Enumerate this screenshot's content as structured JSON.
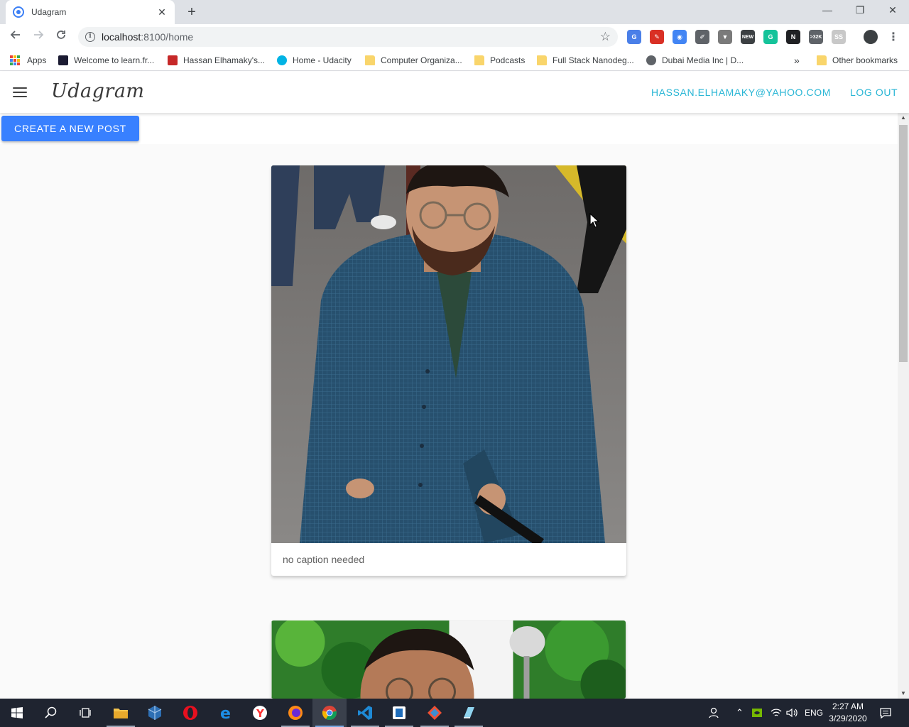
{
  "browser": {
    "tab_title": "Udagram",
    "tab_close_glyph": "✕",
    "new_tab_glyph": "+",
    "url_host": "localhost",
    "url_rest": ":8100/home",
    "window_controls": {
      "minimize": "—",
      "restore": "❐",
      "close": "✕"
    },
    "extensions": [
      {
        "icon": "google-translate-icon",
        "color": "#4a7fe8",
        "text": "G"
      },
      {
        "icon": "pin-extension-icon",
        "color": "#d93025",
        "text": "✎"
      },
      {
        "icon": "chrome-circle-icon",
        "color": "#4285f4",
        "text": "◉"
      },
      {
        "icon": "eyedropper-icon",
        "color": "#5f6368",
        "text": "✐"
      },
      {
        "icon": "vue-devtools-icon",
        "color": "#7a7a7a",
        "text": "▼"
      },
      {
        "icon": "news-icon",
        "color": "#3c4043",
        "text": "NEW"
      },
      {
        "icon": "grammarly-icon",
        "color": "#15c39a",
        "text": "G"
      },
      {
        "icon": "notion-icon",
        "color": "#202124",
        "text": "N"
      },
      {
        "icon": "gmail-checker-icon",
        "color": "#5f6368",
        "text": ">32K"
      },
      {
        "icon": "ss-extension-icon",
        "color": "#c8c8c8",
        "text": "SS"
      }
    ],
    "bookmarks": [
      {
        "label": "Apps",
        "icon": "apps-grid-icon"
      },
      {
        "label": "Welcome to learn.fr...",
        "icon": "freecodecamp-icon",
        "color": "#1b1b32"
      },
      {
        "label": "Hassan Elhamaky's...",
        "icon": "site-favicon-icon",
        "color": "#c62828"
      },
      {
        "label": "Home - Udacity",
        "icon": "udacity-icon",
        "color": "#02b3e4"
      },
      {
        "label": "Computer Organiza...",
        "icon": "folder-icon"
      },
      {
        "label": "Podcasts",
        "icon": "folder-icon"
      },
      {
        "label": "Full Stack Nanodeg...",
        "icon": "folder-icon"
      },
      {
        "label": "Dubai Media Inc | D...",
        "icon": "globe-icon",
        "color": "#5f6368"
      },
      {
        "label": "»",
        "icon": "overflow-chevron-icon"
      },
      {
        "label": "Other bookmarks",
        "icon": "folder-icon"
      }
    ]
  },
  "app": {
    "brand": "Udagram",
    "user_email": "HASSAN.ELHAMAKY@YAHOO.COM",
    "logout_label": "LOG OUT",
    "create_post_label": "CREATE A NEW POST",
    "posts": [
      {
        "caption": "no caption needed"
      },
      {
        "caption": ""
      }
    ]
  },
  "taskbar": {
    "language": "ENG",
    "time": "2:27 AM",
    "date": "3/29/2020"
  }
}
